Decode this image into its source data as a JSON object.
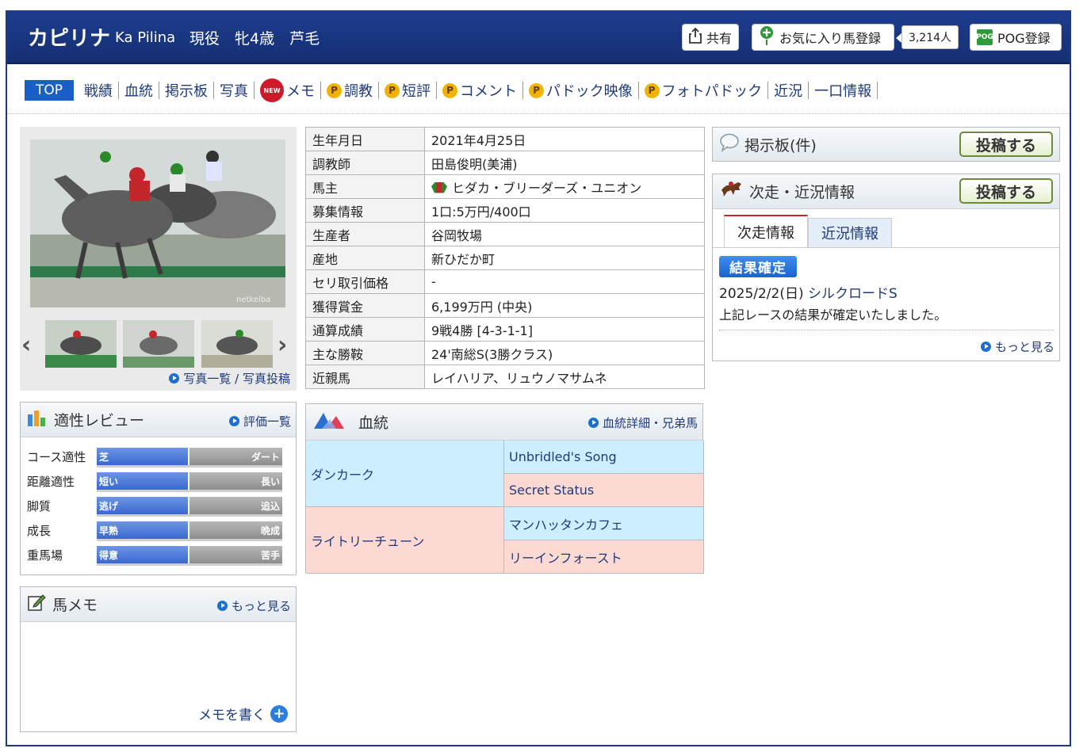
{
  "header": {
    "horse_name": "カピリナ",
    "horse_name_en": "Ka Pilina",
    "status": "現役　牝4歳　芦毛",
    "share_label": "共有",
    "favorite_label": "お気に入り馬登録",
    "favorite_count": "3,214人",
    "pog_icon_text": "POG",
    "pog_label": "POG登録"
  },
  "nav": {
    "top": "TOP",
    "results": "戦績",
    "pedigree": "血統",
    "board": "掲示板",
    "photos": "写真",
    "new_badge": "NEW",
    "memo": "メモ",
    "p_badge": "P",
    "training": "調教",
    "short_review": "短評",
    "comment": "コメント",
    "paddock_video": "パドック映像",
    "photo_paddock": "フォトパドック",
    "recent": "近況",
    "pog_info": "一口情報"
  },
  "photos": {
    "main_watermark": "netkeiba",
    "list_link": "写真一覧 / 写真投稿"
  },
  "profile": {
    "rows": [
      {
        "k": "生年月日",
        "v": "2021年4月25日"
      },
      {
        "k": "調教師",
        "v": "田島俊明(美浦)"
      },
      {
        "k": "馬主",
        "v": "ヒダカ・ブリーダーズ・ユニオン"
      },
      {
        "k": "募集情報",
        "v": "1口:5万円/400口"
      },
      {
        "k": "生産者",
        "v": "谷岡牧場"
      },
      {
        "k": "産地",
        "v": "新ひだか町"
      },
      {
        "k": "セリ取引価格",
        "v": "-"
      },
      {
        "k": "獲得賞金",
        "v": "6,199万円 (中央)"
      },
      {
        "k": "通算成績",
        "v": "9戦4勝 [4-3-1-1]"
      },
      {
        "k": "主な勝鞍",
        "v": "24'南総S(3勝クラス)"
      },
      {
        "k": "近親馬",
        "v": "レイハリア、リュウノマサムネ"
      }
    ]
  },
  "aptitude": {
    "title": "適性レビュー",
    "link": "評価一覧",
    "rows": [
      {
        "label": "コース適性",
        "left": "芝",
        "right": "ダート"
      },
      {
        "label": "距離適性",
        "left": "短い",
        "right": "長い"
      },
      {
        "label": "脚質",
        "left": "逃げ",
        "right": "追込"
      },
      {
        "label": "成長",
        "left": "早熟",
        "right": "晩成"
      },
      {
        "label": "重馬場",
        "left": "得意",
        "right": "苦手"
      }
    ]
  },
  "memo": {
    "title": "馬メモ",
    "more": "もっと見る",
    "write": "メモを書く"
  },
  "pedigree": {
    "title": "血統",
    "link": "血統詳細・兄弟馬",
    "sire": "ダンカーク",
    "dam": "ライトリーチューン",
    "sire_sire": "Unbridled's Song",
    "sire_dam": "Secret Status",
    "dam_sire": "マンハッタンカフェ",
    "dam_dam": "リーインフォースト"
  },
  "board": {
    "title": "掲示板(件)",
    "post": "投稿する"
  },
  "news": {
    "title": "次走・近況情報",
    "post": "投稿する",
    "tab_next": "次走情報",
    "tab_recent": "近況情報",
    "badge": "結果確定",
    "race_date": "2025/2/2(日)",
    "race_name": "シルクロードS",
    "message": "上記レースの結果が確定いたしました。",
    "more": "もっと見る"
  }
}
